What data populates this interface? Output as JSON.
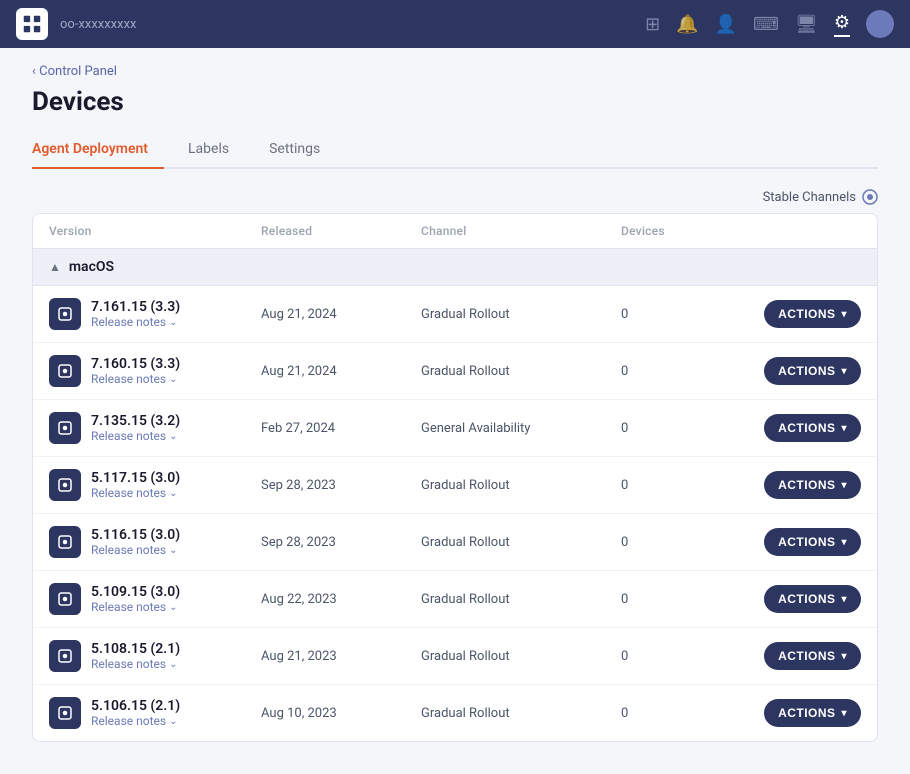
{
  "topnav": {
    "logo_alt": "App logo",
    "app_name": "oo-xxxxxxxxx",
    "icons": [
      "grid-icon",
      "bell-icon",
      "user-icon",
      "terminal-icon",
      "monitor-icon",
      "gear-icon"
    ],
    "gear_active": true
  },
  "breadcrumb": "Control Panel",
  "page_title": "Devices",
  "tabs": [
    {
      "id": "agent-deployment",
      "label": "Agent Deployment",
      "active": true
    },
    {
      "id": "labels",
      "label": "Labels",
      "active": false
    },
    {
      "id": "settings",
      "label": "Settings",
      "active": false
    }
  ],
  "stable_channels": "Stable Channels",
  "table": {
    "columns": [
      "Version",
      "Released",
      "Channel",
      "Devices",
      ""
    ],
    "group": {
      "label": "macOS",
      "expanded": true
    },
    "rows": [
      {
        "version": "7.161.15 (3.3)",
        "release_notes": "Release notes",
        "released": "Aug 21, 2024",
        "channel": "Gradual Rollout",
        "devices": "0"
      },
      {
        "version": "7.160.15 (3.3)",
        "release_notes": "Release notes",
        "released": "Aug 21, 2024",
        "channel": "Gradual Rollout",
        "devices": "0"
      },
      {
        "version": "7.135.15 (3.2)",
        "release_notes": "Release notes",
        "released": "Feb 27, 2024",
        "channel": "General Availability",
        "devices": "0"
      },
      {
        "version": "5.117.15 (3.0)",
        "release_notes": "Release notes",
        "released": "Sep 28, 2023",
        "channel": "Gradual Rollout",
        "devices": "0"
      },
      {
        "version": "5.116.15 (3.0)",
        "release_notes": "Release notes",
        "released": "Sep 28, 2023",
        "channel": "Gradual Rollout",
        "devices": "0"
      },
      {
        "version": "5.109.15 (3.0)",
        "release_notes": "Release notes",
        "released": "Aug 22, 2023",
        "channel": "Gradual Rollout",
        "devices": "0"
      },
      {
        "version": "5.108.15 (2.1)",
        "release_notes": "Release notes",
        "released": "Aug 21, 2023",
        "channel": "Gradual Rollout",
        "devices": "0"
      },
      {
        "version": "5.106.15 (2.1)",
        "release_notes": "Release notes",
        "released": "Aug 10, 2023",
        "channel": "Gradual Rollout",
        "devices": "0"
      }
    ],
    "actions_label": "ACTIONS"
  }
}
